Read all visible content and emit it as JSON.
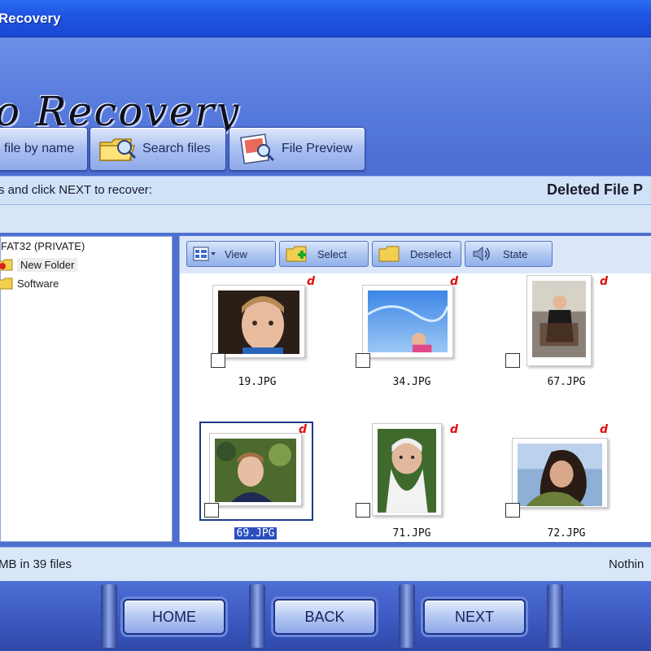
{
  "window": {
    "title": "Recovery"
  },
  "header": {
    "logo_text": "o Recovery"
  },
  "tabs": [
    {
      "label": "file by name",
      "icon": "find-by-name-icon"
    },
    {
      "label": "Search files",
      "icon": "folder-search-icon"
    },
    {
      "label": "File Preview",
      "icon": "file-preview-icon"
    }
  ],
  "instruction": {
    "left": "s and click NEXT to recover:",
    "right": "Deleted File P"
  },
  "tree": {
    "items": [
      {
        "label": "FAT32 (PRIVATE)",
        "selected": false
      },
      {
        "label": "New Folder",
        "selected": true
      },
      {
        "label": "Software",
        "selected": false
      }
    ]
  },
  "toolbar": {
    "view": "View",
    "select": "Select",
    "deselect": "Deselect",
    "state": "State"
  },
  "files": [
    {
      "name": "19.JPG",
      "deleted_flag": "d",
      "selected": false
    },
    {
      "name": "34.JPG",
      "deleted_flag": "d",
      "selected": false
    },
    {
      "name": "67.JPG",
      "deleted_flag": "d",
      "selected": false
    },
    {
      "name": "69.JPG",
      "deleted_flag": "d",
      "selected": true
    },
    {
      "name": "71.JPG",
      "deleted_flag": "d",
      "selected": false
    },
    {
      "name": "72.JPG",
      "deleted_flag": "d",
      "selected": false
    }
  ],
  "status": {
    "left": "MB in 39 files",
    "right": "Nothin"
  },
  "nav": {
    "home": "HOME",
    "back": "BACK",
    "next": "NEXT"
  },
  "colors": {
    "title_bar": "#1f55e3",
    "header": "#5679dc",
    "panel_bg": "#d9e8f8",
    "deleted_flag": "#e01010",
    "selection": "#2b4fc0"
  }
}
